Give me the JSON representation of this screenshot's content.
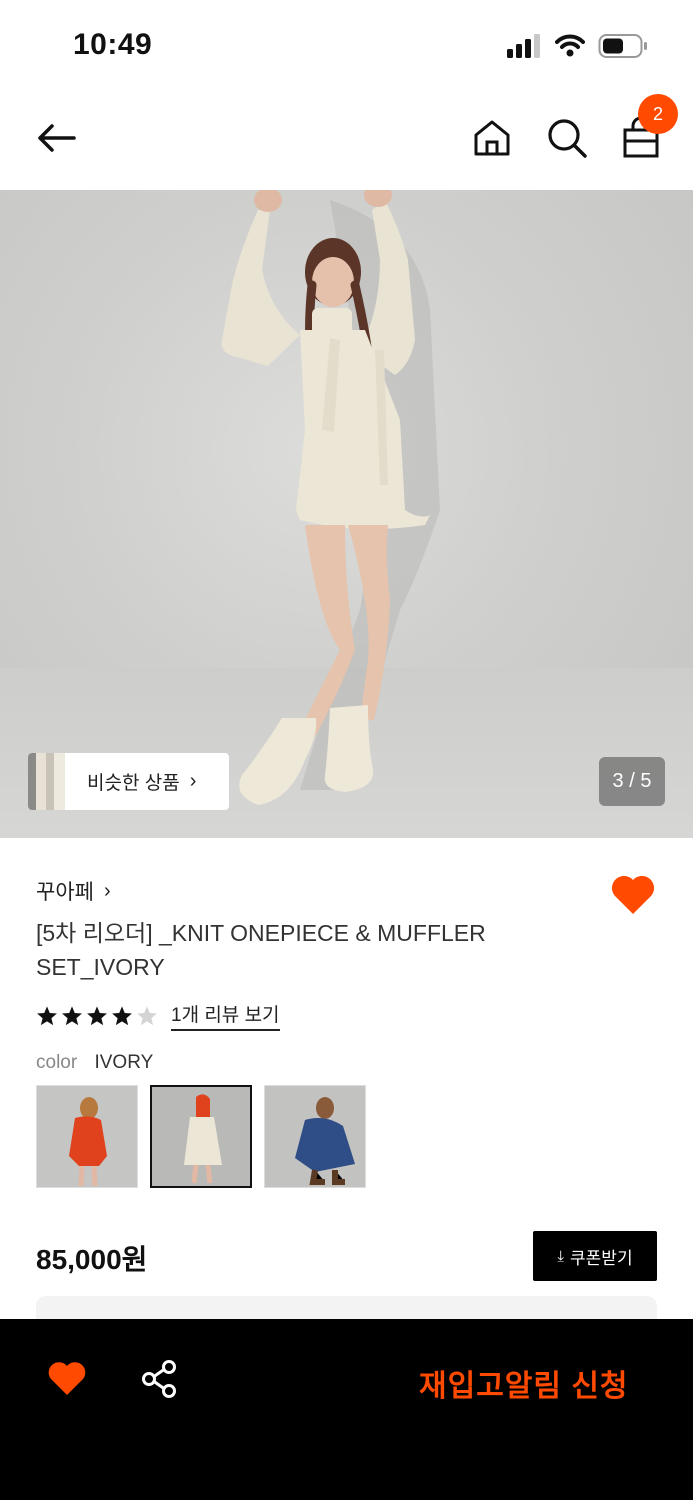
{
  "status_bar": {
    "time": "10:49"
  },
  "nav": {
    "cart_count": "2"
  },
  "hero": {
    "similar_label": "비슷한 상품",
    "pager": "3 / 5"
  },
  "product": {
    "brand": "꾸아페",
    "title": "[5차 리오더] _KNIT ONEPIECE & MUFFLER SET_IVORY",
    "rating_stars": 4,
    "rating_max": 5,
    "review_link": "1개 리뷰 보기",
    "color_label": "color",
    "color_value": "IVORY",
    "swatches": [
      "red",
      "ivory",
      "blue"
    ],
    "selected_swatch": 1,
    "price": "85,000원",
    "coupon_label": "쿠폰받기"
  },
  "bottom_bar": {
    "restock_label": "재입고알림 신청"
  },
  "colors": {
    "accent": "#ff4a00",
    "bar_bg": "#000000"
  }
}
